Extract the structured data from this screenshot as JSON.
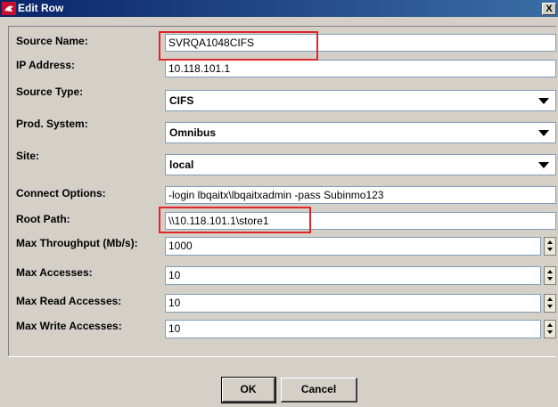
{
  "window": {
    "title": "Edit Row",
    "close_glyph": "X",
    "app_icon": "app-logo-icon"
  },
  "fields": [
    {
      "label": "Source Name:",
      "value": "SVRQA1048CIFS",
      "type": "text",
      "highlighted": true
    },
    {
      "label": "IP Address:",
      "value": "10.118.101.1",
      "type": "text"
    },
    {
      "label": "Source Type:",
      "value": "CIFS",
      "type": "dropdown"
    },
    {
      "label": "Prod. System:",
      "value": "Omnibus",
      "type": "dropdown"
    },
    {
      "label": "Site:",
      "value": "local",
      "type": "dropdown"
    },
    {
      "label": "Connect Options:",
      "value": "-login lbqaitx\\lbqaitxadmin -pass Subinmo123",
      "type": "text"
    },
    {
      "label": "Root Path:",
      "value": "\\\\10.118.101.1\\store1",
      "type": "text",
      "highlighted": true
    },
    {
      "label": "Max Throughput (Mb/s):",
      "value": "1000",
      "type": "spinner"
    },
    {
      "label": "Max Accesses:",
      "value": "10",
      "type": "spinner"
    },
    {
      "label": "Max Read Accesses:",
      "value": "10",
      "type": "spinner"
    },
    {
      "label": "Max Write Accesses:",
      "value": "10",
      "type": "spinner"
    }
  ],
  "buttons": {
    "ok": "OK",
    "cancel": "Cancel"
  },
  "colors": {
    "dialog_bg": "#d4d0c8",
    "title_bar": "#0a246a",
    "highlight": "#e0262a"
  }
}
